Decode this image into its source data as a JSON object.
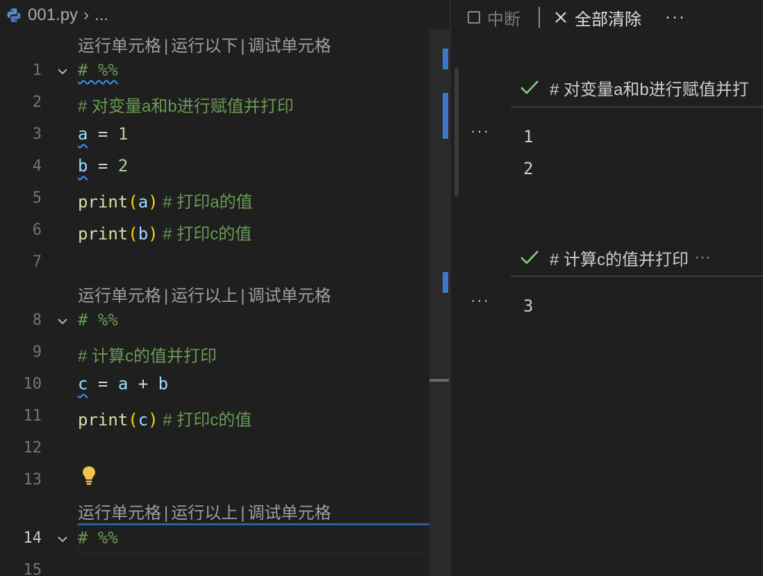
{
  "breadcrumb": {
    "file": "001.py",
    "chevron": "›",
    "ellipsis": "..."
  },
  "editor": {
    "lens_top": {
      "run_cell": "运行单元格",
      "run_below": "运行以下",
      "debug_cell": "调试单元格",
      "sep": "|"
    },
    "lens_mid": {
      "run_cell": "运行单元格",
      "run_above": "运行以上",
      "debug_cell": "调试单元格",
      "sep": "|"
    },
    "lens_bottom": {
      "run_cell": "运行单元格",
      "run_above": "运行以上",
      "debug_cell": "调试单元格",
      "sep": "|"
    },
    "line_numbers": [
      "1",
      "2",
      "3",
      "4",
      "5",
      "6",
      "7",
      "8",
      "9",
      "10",
      "11",
      "12",
      "13",
      "14",
      "15"
    ],
    "code": {
      "l1_marker": "# %%",
      "l2_comment": "# 对变量a和b进行赋值并打印",
      "l3_var": "a",
      "l3_op": " = ",
      "l3_num": "1",
      "l4_var": "b",
      "l4_op": " = ",
      "l4_num": "2",
      "l5_fn": "print",
      "l5_open": "(",
      "l5_arg": "a",
      "l5_close": ")",
      "l5_comment": " # 打印a的值",
      "l6_fn": "print",
      "l6_open": "(",
      "l6_arg": "b",
      "l6_close": ")",
      "l6_comment": " # 打印c的值",
      "l8_marker": "# %%",
      "l9_comment": "# 计算c的值并打印",
      "l10_var": "c",
      "l10_op1": " = ",
      "l10_a": "a",
      "l10_op2": " + ",
      "l10_b": "b",
      "l11_fn": "print",
      "l11_open": "(",
      "l11_arg": "c",
      "l11_close": ")",
      "l11_comment": " # 打印c的值",
      "l14_marker": "# %%"
    }
  },
  "interactive": {
    "toolbar": {
      "interrupt_label": "中断",
      "clear_all_label": "全部清除",
      "more": "···"
    },
    "cells": [
      {
        "header": "# 对变量a和b进行赋值并打",
        "outputs": [
          "1",
          "2"
        ],
        "more": "···"
      },
      {
        "header": "# 计算c的值并打印",
        "header_more": "···",
        "outputs": [
          "3"
        ],
        "more": "···"
      }
    ]
  },
  "colors": {
    "accent": "#3e78c8",
    "check": "#89d185",
    "comment": "#6a9955",
    "variable": "#9cdcfe"
  }
}
